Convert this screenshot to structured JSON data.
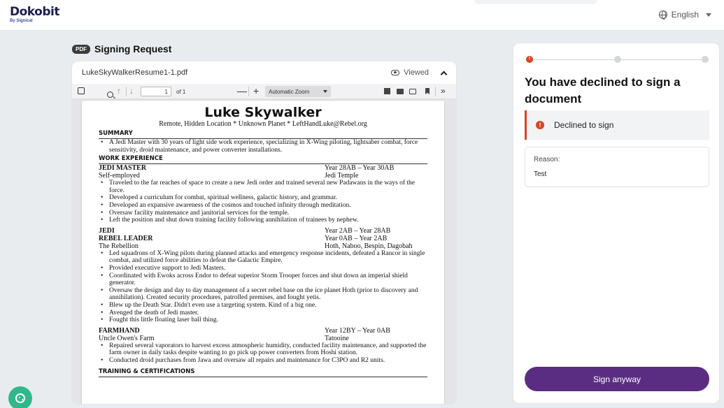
{
  "header": {
    "brand": "Dokobit",
    "brand_sub": "By Signicat",
    "language": "English"
  },
  "document": {
    "badge": "PDF",
    "title": "Signing Request",
    "filename": "LukeSkyWalkerResume1-1.pdf",
    "viewed_label": "Viewed"
  },
  "toolbar": {
    "page_current": "1",
    "page_total": "of 1",
    "zoom_minus": "—",
    "zoom_plus": "+",
    "zoom_mode": "Automatic Zoom",
    "more": "»"
  },
  "resume": {
    "name": "Luke Skywalker",
    "contact": "Remote, Hidden Location * Unknown Planet * LeftHandLuke@Rebel.org",
    "summary_heading": "SUMMARY",
    "summary": "A Jedi Master with 30 years of light side work experience, specializing in X-Wing piloting, lightsaber combat, force sensitivity, droid maintenance, and power converter installations.",
    "work_heading": "WORK EXPERIENCE",
    "job1": {
      "title": "JEDI MASTER",
      "dates": "Year 28AB – Year 30AB",
      "org": "Self-employed",
      "place": "Jedi Temple",
      "bullets": [
        "Traveled to the far reaches of space to create a new Jedi order and trained several new Padawans in the ways of the force.",
        "Developed a curriculum for combat, spiritual wellness, galactic history, and grammar.",
        "Developed an expansive awareness of the cosmos and touched infinity through meditation.",
        "Oversaw facility maintenance and janitorial services for the temple.",
        "Left the position and shut down training facility following annihilation of trainees by nephew."
      ]
    },
    "job2": {
      "title": "JEDI",
      "dates": "Year 2AB – Year 28AB",
      "title2": "REBEL LEADER",
      "dates2": "Year 0AB – Year 2AB",
      "org": "The Rebellion",
      "place": "Hoth, Naboo, Bespin, Dagobah",
      "bullets": [
        "Led squadrons of X-Wing pilots during planned attacks and emergency response incidents, defeated a Rancor in single combat, and utilized force abilities to defeat the Galactic Empire.",
        "Provided executive support to Jedi Masters.",
        "Coordinated with Ewoks across Endor to defeat superior Storm Trooper forces and shut down an imperial shield generator.",
        "Oversaw the design and day to day management of a secret rebel base on the ice planet Hoth (prior to discovery and annihilation). Created security procedures, patrolled premises, and fought yetis.",
        "Blew up the Death Star. Didn't even use a targeting system. Kind of a big one.",
        "Avenged the death of Jedi master.",
        "Fought this little floating laser ball thing."
      ]
    },
    "job3": {
      "title": "FARMHAND",
      "dates": "Year 12BY – Year 0AB",
      "org": "Uncle Owen's Farm",
      "place": "Tatooine",
      "bullets": [
        "Repaired several vaporators to harvest excess atmospheric humidity, conducted facility maintenance, and supported the farm owner in daily tasks despite wanting to go pick up power converters from Hoshi station.",
        "Conducted droid purchases from Jawa and oversaw all repairs and maintenance for C3PO and R2 units."
      ]
    },
    "training_heading": "TRAINING & CERTIFICATIONS"
  },
  "panel": {
    "step_error_mark": "!",
    "title": "You have declined to sign a document",
    "declined_label": "Declined to sign",
    "alert_mark": "!",
    "reason_label": "Reason:",
    "reason_value": "Test",
    "sign_button": "Sign anyway"
  },
  "colors": {
    "primary": "#5a2d82",
    "error": "#d6451f",
    "cookie": "#2fb88a"
  },
  "icons": [
    "globe-icon",
    "eye-icon",
    "chevron-up-icon",
    "search-icon",
    "print-icon",
    "bookmark-icon",
    "cookie-icon",
    "alert-icon"
  ]
}
